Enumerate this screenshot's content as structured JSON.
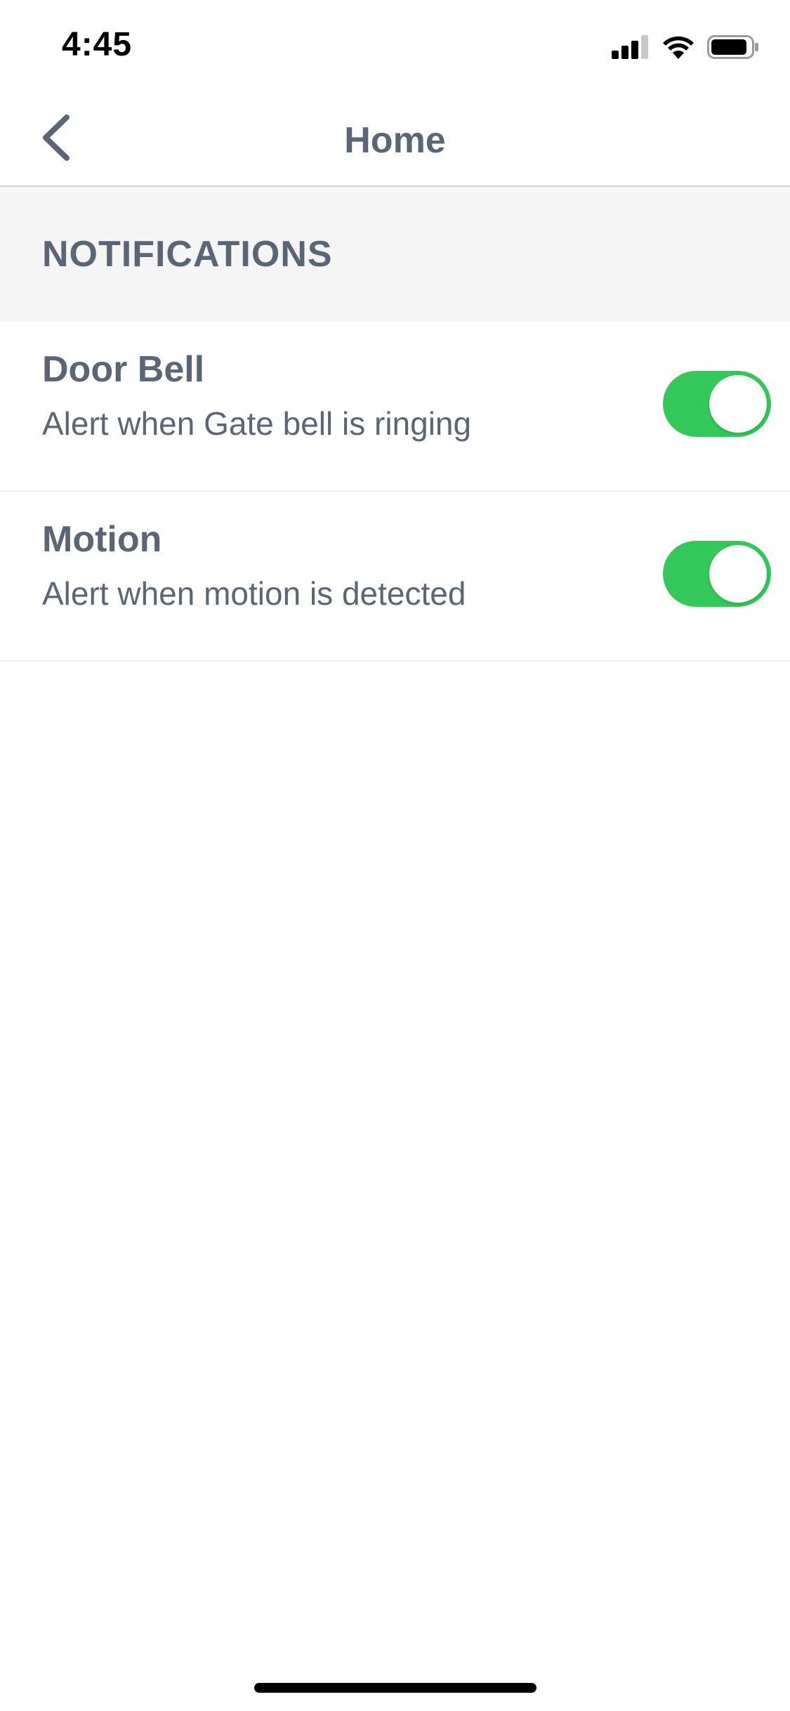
{
  "status_bar": {
    "time": "4:45",
    "icons": [
      "signal-icon",
      "wifi-icon",
      "battery-icon"
    ]
  },
  "nav": {
    "title": "Home",
    "back_icon": "chevron-left-icon"
  },
  "section": {
    "title": "NOTIFICATIONS"
  },
  "items": [
    {
      "title": "Door Bell",
      "subtitle": "Alert when Gate bell is ringing",
      "enabled": true
    },
    {
      "title": "Motion",
      "subtitle": "Alert when motion is detected",
      "enabled": true
    }
  ],
  "colors": {
    "toggle_on": "#34c759",
    "text": "#5a6675",
    "section_bg": "#f5f5f5"
  }
}
